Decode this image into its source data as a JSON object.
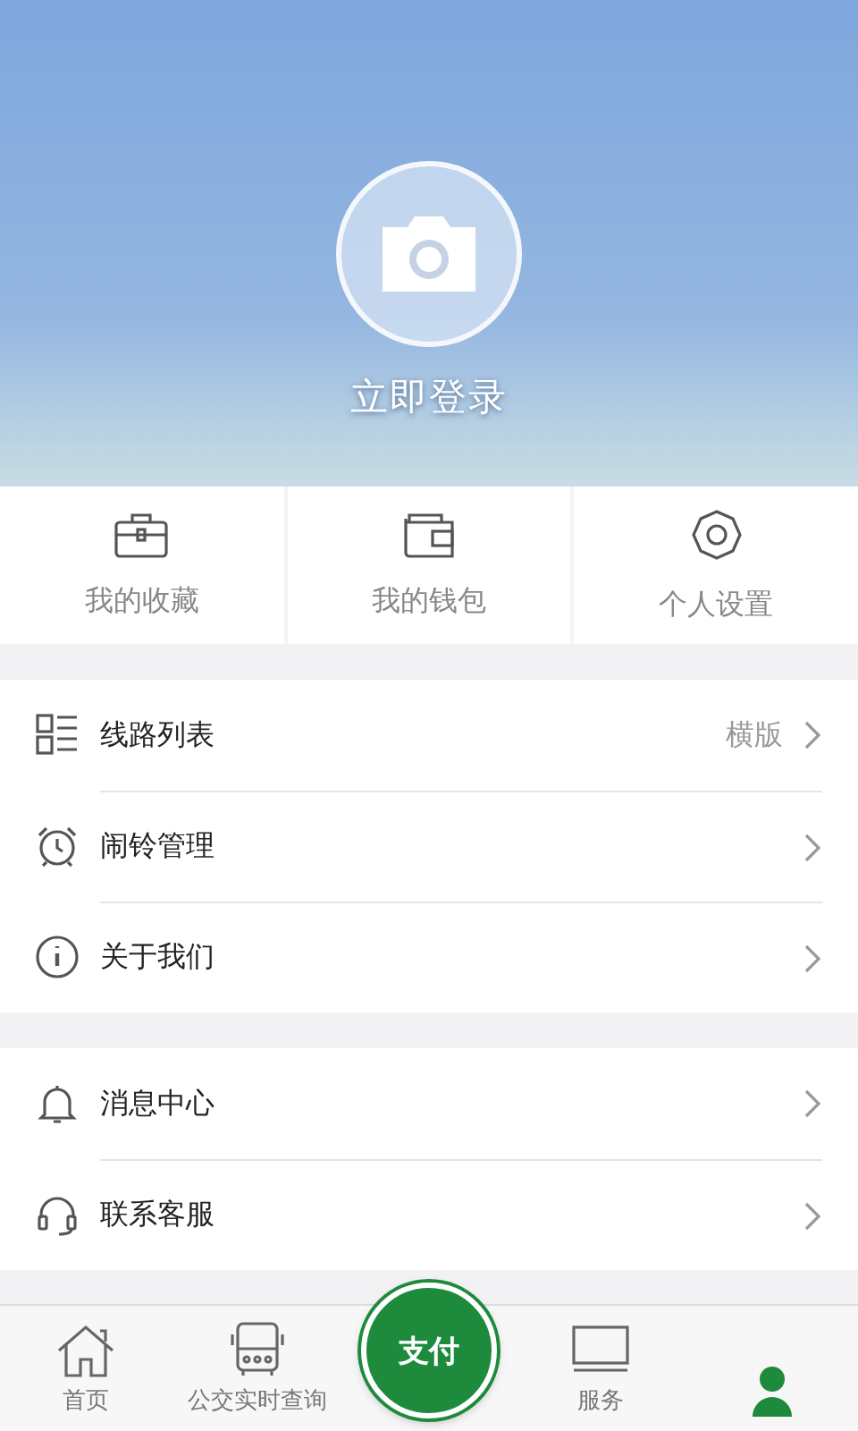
{
  "profile": {
    "login_label": "立即登录"
  },
  "quick_actions": [
    {
      "kind": "briefcase",
      "label": "我的收藏"
    },
    {
      "kind": "wallet",
      "label": "我的钱包"
    },
    {
      "kind": "gear",
      "label": "个人设置"
    }
  ],
  "menu_groups": [
    [
      {
        "kind": "list",
        "label": "线路列表",
        "value": "横版"
      },
      {
        "kind": "alarm",
        "label": "闹铃管理"
      },
      {
        "kind": "info",
        "label": "关于我们"
      }
    ],
    [
      {
        "kind": "bell",
        "label": "消息中心"
      },
      {
        "kind": "headset",
        "label": "联系客服"
      }
    ]
  ],
  "tab_bar": {
    "tabs": [
      {
        "kind": "home",
        "label": "首页",
        "selected": false
      },
      {
        "kind": "bus",
        "label": "公交实时查询",
        "selected": false
      },
      {
        "kind": "pay",
        "label": "支付",
        "selected": false
      },
      {
        "kind": "monitor",
        "label": "服务",
        "selected": false
      },
      {
        "kind": "person",
        "selected": true
      }
    ]
  }
}
